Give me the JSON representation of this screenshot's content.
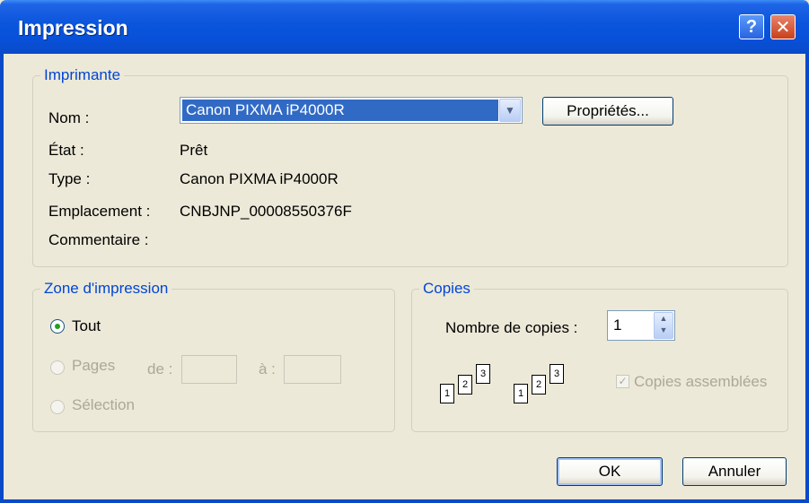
{
  "window": {
    "title": "Impression",
    "help_glyph": "?",
    "close_glyph": "✕"
  },
  "printer": {
    "legend": "Imprimante",
    "name_label": "Nom :",
    "name_value": "Canon PIXMA iP4000R",
    "properties_button": "Propriétés...",
    "status_label": "État :",
    "status_value": "Prêt",
    "type_label": "Type :",
    "type_value": "Canon PIXMA iP4000R",
    "location_label": "Emplacement :",
    "location_value": "CNBJNP_00008550376F",
    "comment_label": "Commentaire :",
    "comment_value": ""
  },
  "print_range": {
    "legend": "Zone d'impression",
    "all_label": "Tout",
    "pages_label": "Pages",
    "from_label": "de :",
    "to_label": "à :",
    "from_value": "",
    "to_value": "",
    "selection_label": "Sélection",
    "selected": "all"
  },
  "copies": {
    "legend": "Copies",
    "count_label": "Nombre de copies :",
    "count_value": "1",
    "collate_label": "Copies assemblées",
    "collate_checked": true,
    "collate_disabled": true,
    "collate_icon_pages": [
      "1",
      "2",
      "3"
    ]
  },
  "footer": {
    "ok_button": "OK",
    "cancel_button": "Annuler"
  },
  "colors": {
    "titlebar": "#0A55DC",
    "legend": "#0046D5",
    "selection": "#316AC5",
    "background": "#ECE9D8"
  }
}
